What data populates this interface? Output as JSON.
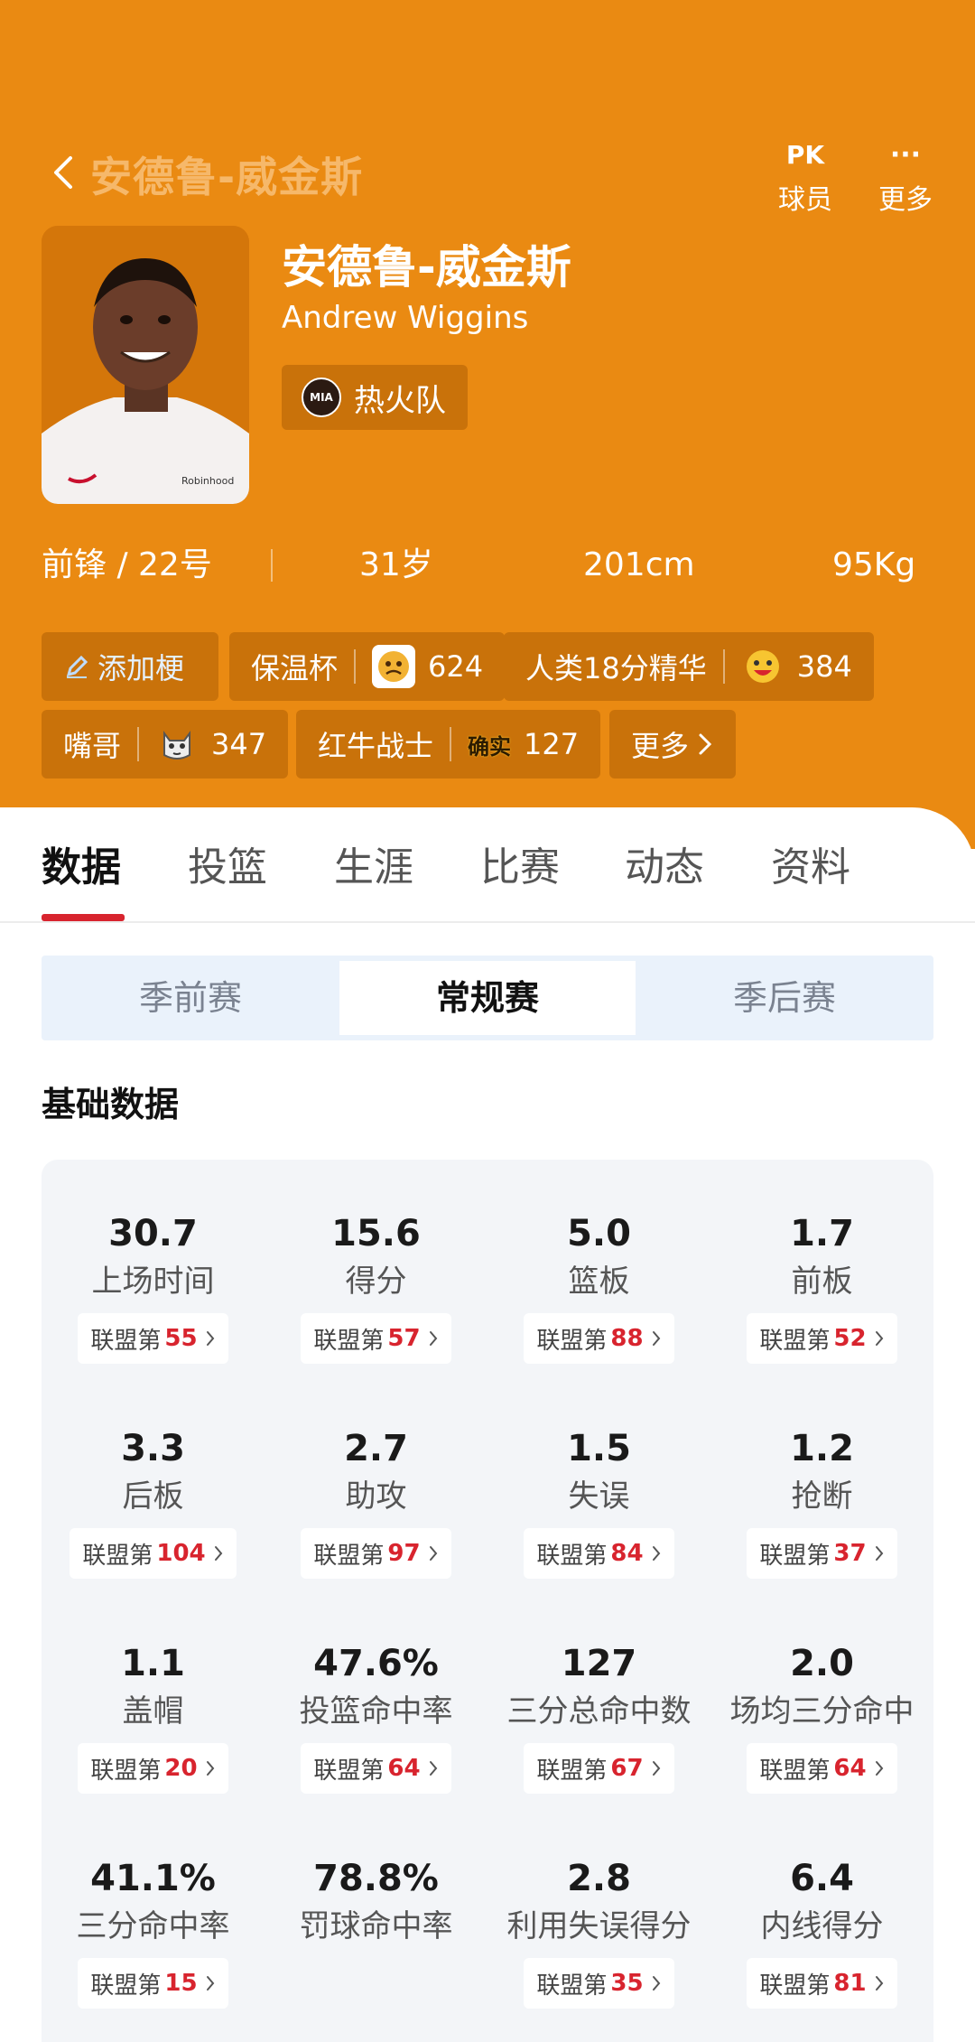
{
  "nav": {
    "title": "安德鲁-威金斯",
    "pk_label": "球员",
    "more_label": "更多",
    "pk_icon_text": "PK",
    "more_icon_text": "···"
  },
  "player": {
    "name_cn": "安德鲁-威金斯",
    "name_en": "Andrew Wiggins",
    "team": "热火队",
    "team_logo_text": "MIA",
    "position_number": "前锋 / 22号",
    "age": "31岁",
    "height": "201cm",
    "weight": "95Kg"
  },
  "tags": {
    "add_label": "添加梗",
    "items": [
      {
        "label": "保温杯",
        "count": "624"
      },
      {
        "label": "人类18分精华",
        "count": "384"
      },
      {
        "label": "嘴哥",
        "count": "347"
      },
      {
        "label": "红牛战士",
        "count": "127",
        "emoji_text": "确实"
      }
    ],
    "more_label": "更多"
  },
  "tabs": [
    "数据",
    "投篮",
    "生涯",
    "比赛",
    "动态",
    "资料"
  ],
  "season_tabs": [
    "季前赛",
    "常规赛",
    "季后赛"
  ],
  "section_title": "基础数据",
  "rank_prefix": "联盟第",
  "stats": [
    {
      "value": "30.7",
      "label": "上场时间",
      "rank": "55"
    },
    {
      "value": "15.6",
      "label": "得分",
      "rank": "57"
    },
    {
      "value": "5.0",
      "label": "篮板",
      "rank": "88"
    },
    {
      "value": "1.7",
      "label": "前板",
      "rank": "52"
    },
    {
      "value": "3.3",
      "label": "后板",
      "rank": "104"
    },
    {
      "value": "2.7",
      "label": "助攻",
      "rank": "97"
    },
    {
      "value": "1.5",
      "label": "失误",
      "rank": "84"
    },
    {
      "value": "1.2",
      "label": "抢断",
      "rank": "37"
    },
    {
      "value": "1.1",
      "label": "盖帽",
      "rank": "20"
    },
    {
      "value": "47.6%",
      "label": "投篮命中率",
      "rank": "64"
    },
    {
      "value": "127",
      "label": "三分总命中数",
      "rank": "67"
    },
    {
      "value": "2.0",
      "label": "场均三分命中",
      "rank": "64"
    },
    {
      "value": "41.1%",
      "label": "三分命中率",
      "rank": "15"
    },
    {
      "value": "78.8%",
      "label": "罚球命中率",
      "rank": ""
    },
    {
      "value": "2.8",
      "label": "利用失误得分",
      "rank": "35"
    },
    {
      "value": "6.4",
      "label": "内线得分",
      "rank": "81"
    }
  ],
  "colors": {
    "header": "#EA8A12",
    "chip": "#C9720A",
    "accent_red": "#D8242E",
    "card_bg": "#F3F5F8",
    "segment_bg": "#EAF2FB"
  }
}
